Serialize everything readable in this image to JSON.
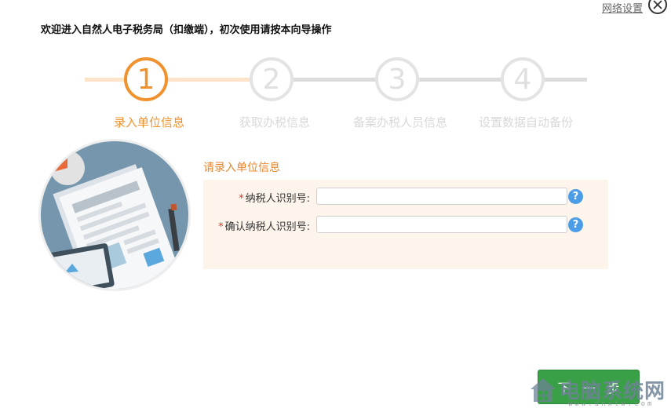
{
  "topbar": {
    "network_settings_label": "网络设置",
    "close_icon": "close-icon"
  },
  "welcome_text": "欢迎进入自然人电子税务局（扣缴端），初次使用请按本向导操作",
  "steps": [
    {
      "number": "1",
      "label": "录入单位信息",
      "state": "active"
    },
    {
      "number": "2",
      "label": "获取办税信息",
      "state": "inactive"
    },
    {
      "number": "3",
      "label": "备案办税人员信息",
      "state": "inactive"
    },
    {
      "number": "4",
      "label": "设置数据自动备份",
      "state": "inactive"
    }
  ],
  "form": {
    "title": "请录入单位信息",
    "fields": [
      {
        "required_mark": "*",
        "label": "纳税人识别号:",
        "value": "",
        "help_icon": "question-icon",
        "help_text": "?"
      },
      {
        "required_mark": "*",
        "label": "确认纳税人识别号:",
        "value": "",
        "help_icon": "question-icon",
        "help_text": "?"
      }
    ]
  },
  "next_button_label": "下一步",
  "watermark": {
    "text": "电脑系统网",
    "url": "www.dnxtw.com"
  },
  "colors": {
    "accent_orange": "#f0922e",
    "panel_bg": "#fdf5ec",
    "button_green": "#3aa047",
    "help_blue": "#4a9de6",
    "inactive_gray": "#e3e3e3"
  }
}
